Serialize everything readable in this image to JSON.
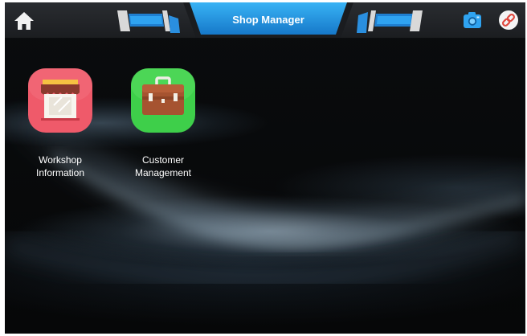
{
  "header": {
    "title": "Shop Manager",
    "home_icon": "home-icon",
    "camera_icon": "camera-icon",
    "link_icon": "link-icon",
    "accent_color": "#1e9be8"
  },
  "apps": [
    {
      "label_line1": "Workshop",
      "label_line2": "Information",
      "icon": "storefront-icon",
      "icon_color": "#ef5a6a"
    },
    {
      "label_line1": "Customer",
      "label_line2": "Management",
      "icon": "briefcase-icon",
      "icon_color": "#3ecf4a"
    }
  ]
}
